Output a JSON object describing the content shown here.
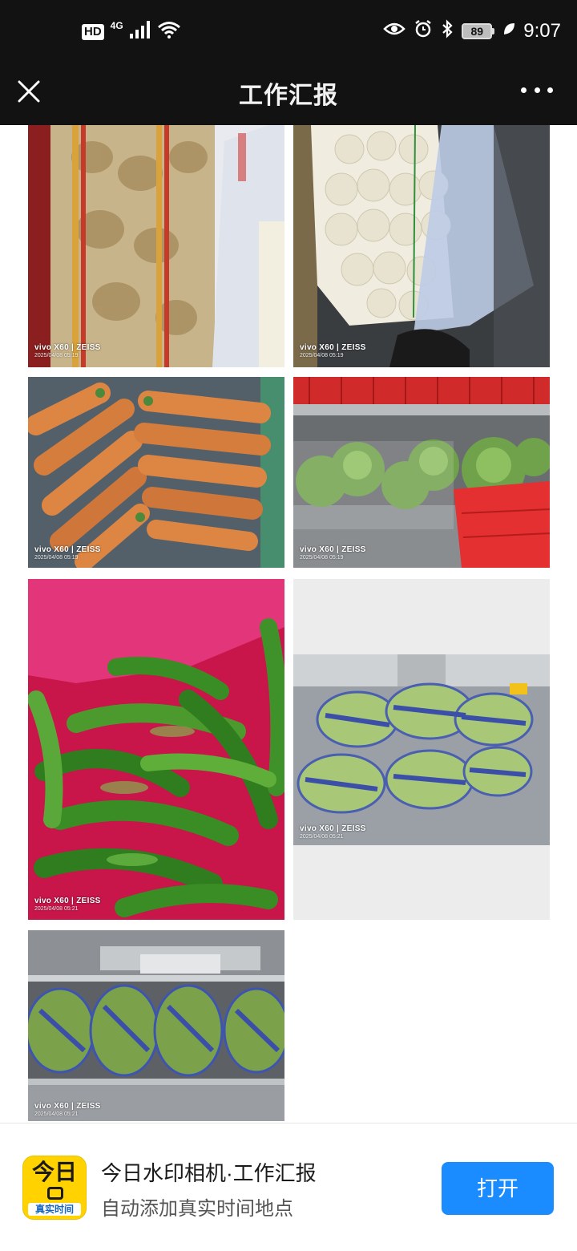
{
  "status_bar": {
    "hd": "HD",
    "network": "4G",
    "battery": "89",
    "time": "9:07"
  },
  "nav": {
    "title": "工作汇报"
  },
  "photos": [
    {
      "label": "potato-sack-photo",
      "brand": "vivo X60 | ZEISS",
      "date": "2025/04/08 05:19"
    },
    {
      "label": "turnip-bag-photo",
      "brand": "vivo X60 | ZEISS",
      "date": "2025/04/08 05:19"
    },
    {
      "label": "carrots-photo",
      "brand": "vivo X60 | ZEISS",
      "date": "2025/04/08 05:19"
    },
    {
      "label": "cabbage-shelf-photo",
      "brand": "vivo X60 | ZEISS",
      "date": "2025/04/08 05:19"
    },
    {
      "label": "green-peppers-photo",
      "brand": "vivo X60 | ZEISS",
      "date": "2025/04/08 05:21"
    },
    {
      "label": "packaged-beans-photo",
      "brand": "vivo X60 | ZEISS",
      "date": "2025/04/08 05:21"
    },
    {
      "label": "packaged-vegetables-shelf-photo",
      "brand": "vivo X60 | ZEISS",
      "date": "2025/04/08 05:21"
    }
  ],
  "banner": {
    "app_icon_top": "今日",
    "app_icon_bottom": "真实时间",
    "title": "今日水印相机·工作汇报",
    "subtitle": "自动添加真实时间地点",
    "open_label": "打开",
    "accent": "#1a8cff"
  }
}
